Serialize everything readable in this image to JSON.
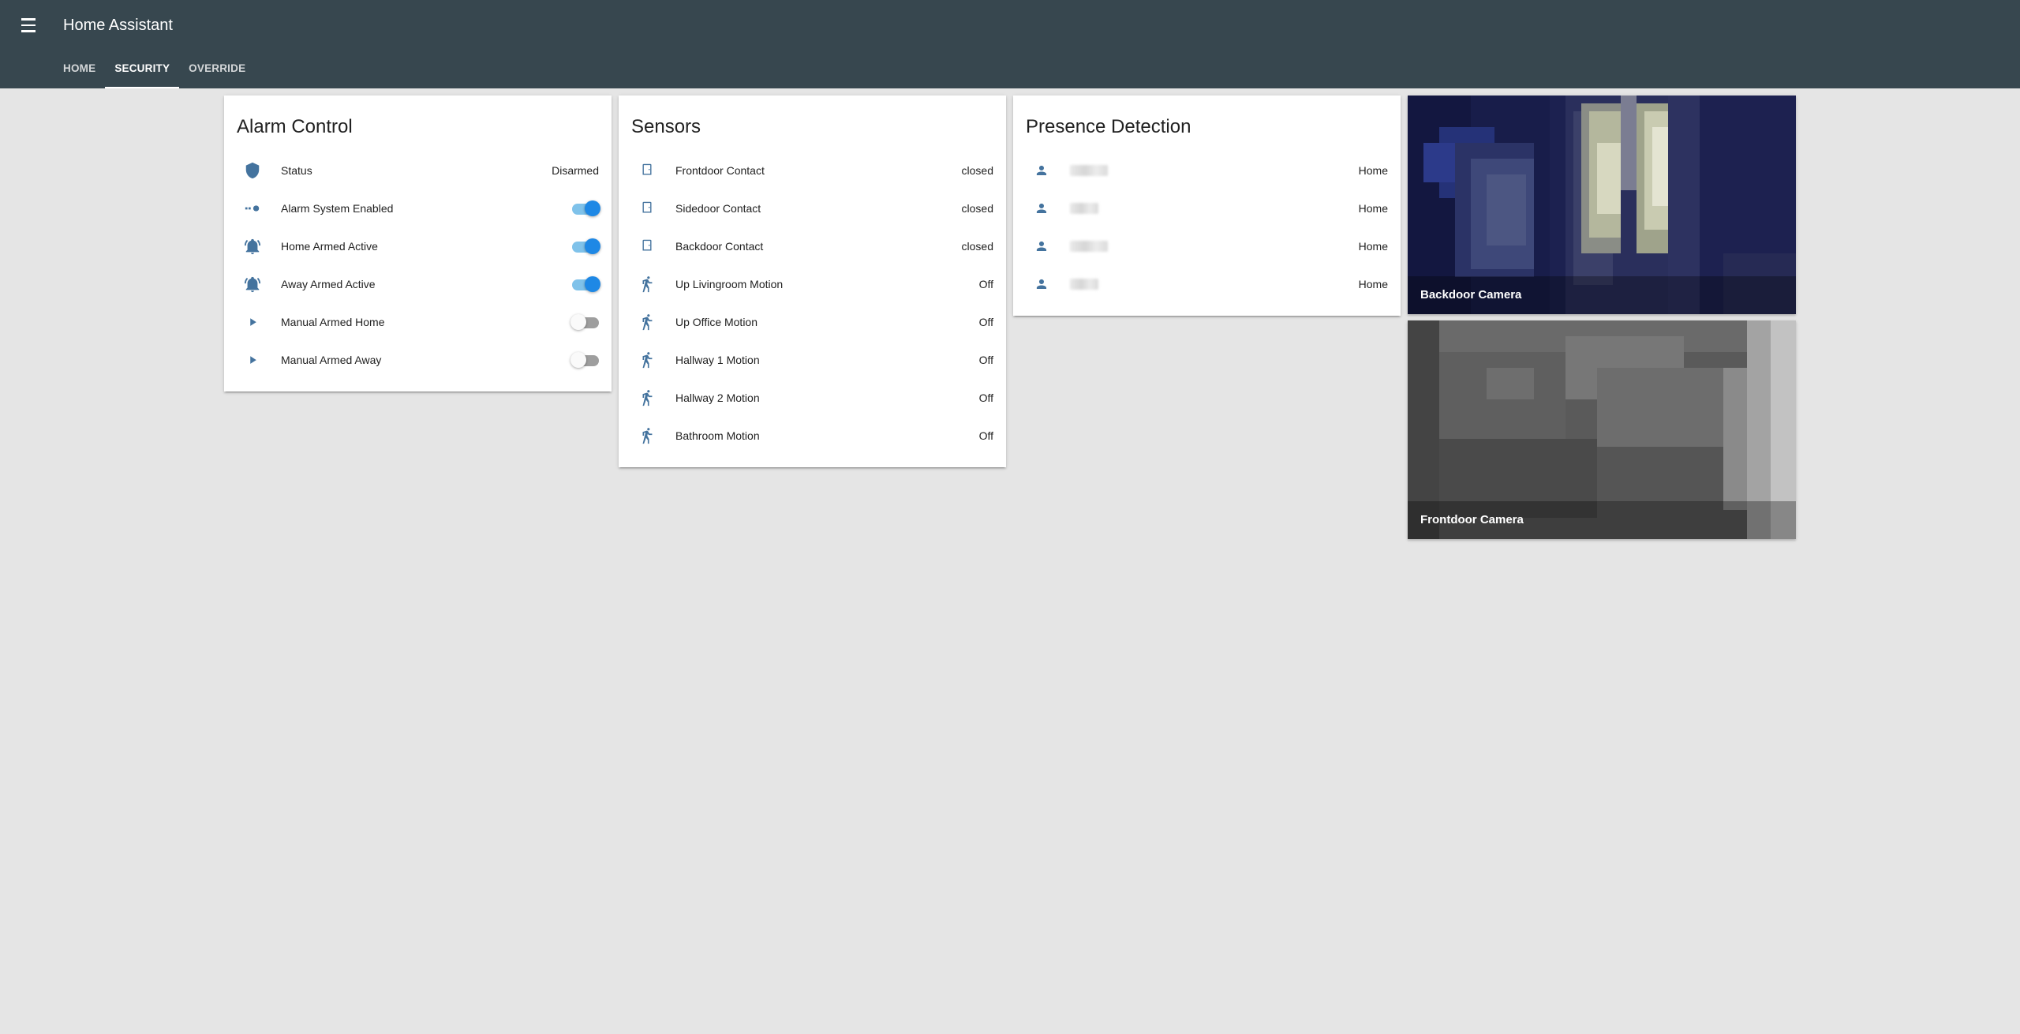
{
  "app": {
    "title": "Home Assistant"
  },
  "tabs": [
    {
      "label": "HOME",
      "active": false
    },
    {
      "label": "SECURITY",
      "active": true
    },
    {
      "label": "OVERRIDE",
      "active": false
    }
  ],
  "colors": {
    "toolbar": "#37474f",
    "background": "#e5e5e5",
    "icon": "#44739e",
    "toggle_on": "#1e88e5"
  },
  "alarm_control": {
    "title": "Alarm Control",
    "rows": [
      {
        "icon": "shield-icon",
        "label": "Status",
        "state": "Disarmed"
      },
      {
        "icon": "toggle-switch-icon",
        "label": "Alarm System Enabled",
        "toggle": "on"
      },
      {
        "icon": "bell-ring-icon",
        "label": "Home Armed Active",
        "toggle": "on"
      },
      {
        "icon": "bell-ring-icon",
        "label": "Away Armed Active",
        "toggle": "on"
      },
      {
        "icon": "play-icon",
        "label": "Manual Armed Home",
        "toggle": "off"
      },
      {
        "icon": "play-icon",
        "label": "Manual Armed Away",
        "toggle": "off"
      }
    ]
  },
  "sensors": {
    "title": "Sensors",
    "rows": [
      {
        "icon": "door-icon",
        "label": "Frontdoor Contact",
        "state": "closed"
      },
      {
        "icon": "door-icon",
        "label": "Sidedoor Contact",
        "state": "closed"
      },
      {
        "icon": "door-icon",
        "label": "Backdoor Contact",
        "state": "closed"
      },
      {
        "icon": "walk-icon",
        "label": "Up Livingroom Motion",
        "state": "Off"
      },
      {
        "icon": "walk-icon",
        "label": "Up Office Motion",
        "state": "Off"
      },
      {
        "icon": "walk-icon",
        "label": "Hallway 1 Motion",
        "state": "Off"
      },
      {
        "icon": "walk-icon",
        "label": "Hallway 2 Motion",
        "state": "Off"
      },
      {
        "icon": "walk-icon",
        "label": "Bathroom Motion",
        "state": "Off"
      }
    ]
  },
  "presence": {
    "title": "Presence Detection",
    "rows": [
      {
        "icon": "account-icon",
        "state": "Home"
      },
      {
        "icon": "account-icon",
        "state": "Home"
      },
      {
        "icon": "account-icon",
        "state": "Home"
      },
      {
        "icon": "account-icon",
        "state": "Home"
      }
    ]
  },
  "cameras": [
    {
      "name": "Backdoor Camera"
    },
    {
      "name": "Frontdoor Camera"
    }
  ]
}
